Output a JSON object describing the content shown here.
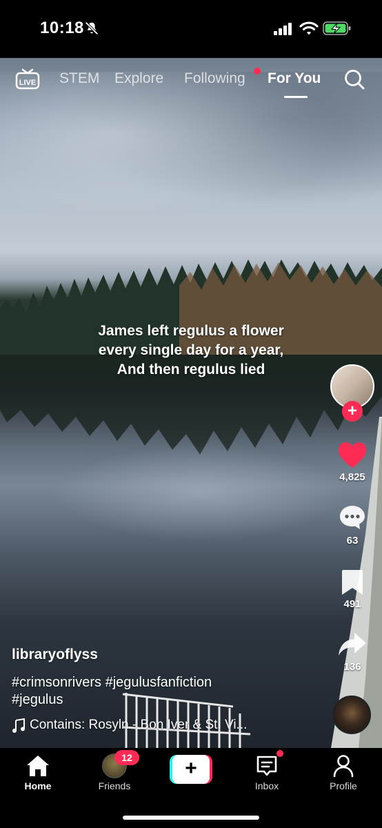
{
  "status_bar": {
    "time": "10:18",
    "icons": [
      "bell-slash-icon",
      "signal-icon",
      "wifi-icon",
      "battery-charging-icon"
    ]
  },
  "top_nav": {
    "live_label": "LIVE",
    "tabs": [
      {
        "label": "STEM"
      },
      {
        "label": "Explore"
      },
      {
        "label": "Following"
      },
      {
        "label": "For You"
      }
    ],
    "active_tab": "For You",
    "search_icon": "search-icon"
  },
  "video": {
    "caption_lines": [
      "James left regulus a flower",
      "every single day for a year,",
      "And then regulus lied"
    ]
  },
  "actions": {
    "likes": "4,825",
    "comments": "63",
    "saves": "491",
    "shares": "136"
  },
  "post": {
    "username": "libraryoflyss",
    "hashtag_lines": [
      "#crimsonrivers #jegulusfanfiction",
      "#jegulus"
    ],
    "sound": "Contains: Rosyln - Bon Iver & St. Vi..."
  },
  "bottom_nav": {
    "home": "Home",
    "friends": "Friends",
    "friends_badge": "12",
    "create_symbol": "+",
    "inbox": "Inbox",
    "profile": "Profile"
  },
  "colors": {
    "accent_red": "#fe2c55",
    "accent_cyan": "#25f4ee",
    "background": "#000000"
  }
}
